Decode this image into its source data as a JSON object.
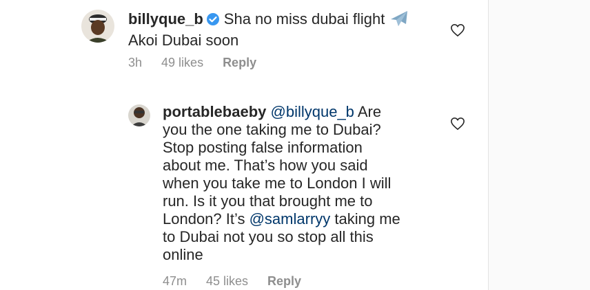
{
  "comments": [
    {
      "username": "billyque_b",
      "text_line1": "Sha no miss dubai flight",
      "emoji": "airplane-emoji",
      "text_line2": "Akoi Dubai soon",
      "time": "3h",
      "likes": "49 likes",
      "reply": "Reply"
    },
    {
      "username": "portablebaeby",
      "mention": "@billyque_b",
      "line1_rest": " Are",
      "line2": "you the one taking me to Dubai?",
      "line3": "Stop posting false information",
      "line4": "about me. That’s how you said",
      "line5": "when you take me to London I will",
      "line6": "run. Is it you that brought me to",
      "line7_pre": "London? It’s ",
      "line7_mention": "@samlarryy",
      "line7_post": " taking me",
      "line8": "to Dubai not you so stop all this",
      "line9": "online",
      "time": "47m",
      "likes": "45 likes",
      "reply": "Reply"
    }
  ],
  "colors": {
    "text": "#262626",
    "meta": "#8e8e8e",
    "mention": "#00376b",
    "verified": "#3897f0"
  },
  "icons": [
    "verified-badge-icon",
    "airplane-emoji",
    "heart-icon"
  ]
}
